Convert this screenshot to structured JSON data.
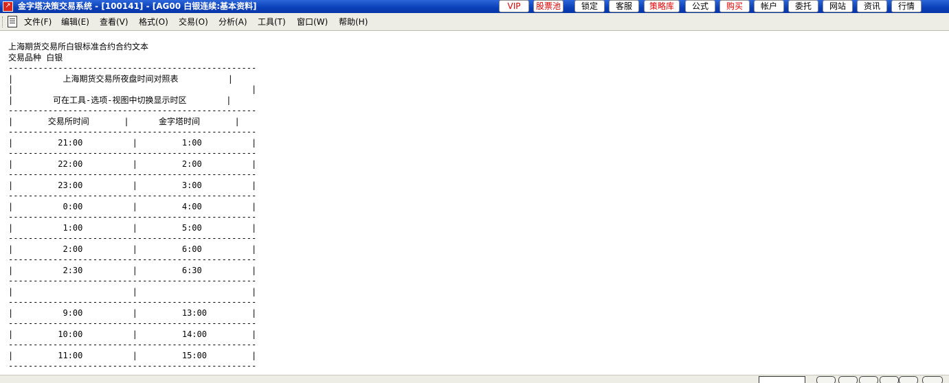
{
  "window": {
    "title": "金字塔决策交易系统 - [100141] - [AG00 白银连续:基本资料]"
  },
  "toolbar_buttons": [
    {
      "label": "VIP",
      "color": "#e00000"
    },
    {
      "label": "股票池",
      "color": "#e00000"
    },
    {
      "label": "锁定",
      "color": "#000000"
    },
    {
      "label": "客服",
      "color": "#000000"
    },
    {
      "label": "策略库",
      "color": "#e00000"
    },
    {
      "label": "公式",
      "color": "#000000"
    },
    {
      "label": "购买",
      "color": "#e00000"
    },
    {
      "label": "帐户",
      "color": "#000000"
    },
    {
      "label": "委托",
      "color": "#000000"
    },
    {
      "label": "网站",
      "color": "#000000"
    },
    {
      "label": "资讯",
      "color": "#000000"
    },
    {
      "label": "行情",
      "color": "#000000"
    }
  ],
  "menu": {
    "items": [
      {
        "label": "文件(F)"
      },
      {
        "label": "编辑(E)"
      },
      {
        "label": "查看(V)"
      },
      {
        "label": "格式(O)"
      },
      {
        "label": "交易(O)"
      },
      {
        "label": "分析(A)"
      },
      {
        "label": "工具(T)"
      },
      {
        "label": "窗口(W)"
      },
      {
        "label": "帮助(H)"
      }
    ]
  },
  "document": {
    "heading": "上海期货交易所白银标准合约合约文本",
    "variety_label": "交易品种 白银",
    "table_title": "上海期货交易所夜盘时间对照表",
    "table_subtitle": "可在工具-选项-视图中切换显示时区",
    "col_exchange": "交易所时间",
    "col_pyramid": "金字塔时间",
    "rows": [
      {
        "exchange": "21:00",
        "pyramid": "1:00"
      },
      {
        "exchange": "22:00",
        "pyramid": "2:00"
      },
      {
        "exchange": "23:00",
        "pyramid": "3:00"
      },
      {
        "exchange": "0:00",
        "pyramid": "4:00"
      },
      {
        "exchange": "1:00",
        "pyramid": "5:00"
      },
      {
        "exchange": "2:00",
        "pyramid": "6:00"
      },
      {
        "exchange": "2:30",
        "pyramid": "6:30"
      },
      {
        "exchange": "",
        "pyramid": ""
      },
      {
        "exchange": "9:00",
        "pyramid": "13:00"
      },
      {
        "exchange": "10:00",
        "pyramid": "14:00"
      },
      {
        "exchange": "11:00",
        "pyramid": "15:00"
      }
    ]
  },
  "status": {
    "text": "",
    "field": ""
  },
  "colors": {
    "titlebar": "#0a3fb8",
    "accent_red": "#e00000",
    "menubar": "#eeede5"
  }
}
